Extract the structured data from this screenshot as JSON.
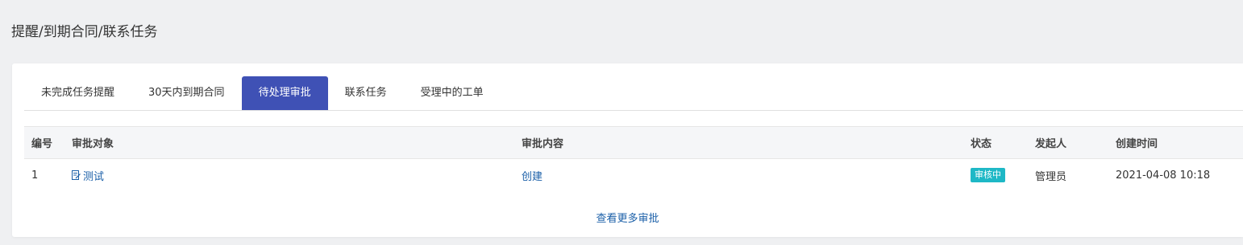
{
  "breadcrumb": "提醒/到期合同/联系任务",
  "tabs": [
    {
      "label": "未完成任务提醒",
      "active": false
    },
    {
      "label": "30天内到期合同",
      "active": false
    },
    {
      "label": "待处理审批",
      "active": true
    },
    {
      "label": "联系任务",
      "active": false
    },
    {
      "label": "受理中的工单",
      "active": false
    }
  ],
  "table": {
    "headers": {
      "num": "编号",
      "object": "审批对象",
      "content": "审批内容",
      "status": "状态",
      "initiator": "发起人",
      "created": "创建时间"
    },
    "rows": [
      {
        "num": "1",
        "object": "测试",
        "object_icon": "document-edit-icon",
        "content": "创建",
        "status": "审核中",
        "initiator": "管理员",
        "created": "2021-04-08 10:18"
      }
    ]
  },
  "more_link": "查看更多审批",
  "colors": {
    "accent": "#3f51b5",
    "link": "#1a5fa8",
    "status_badge": "#1eb8c6"
  }
}
